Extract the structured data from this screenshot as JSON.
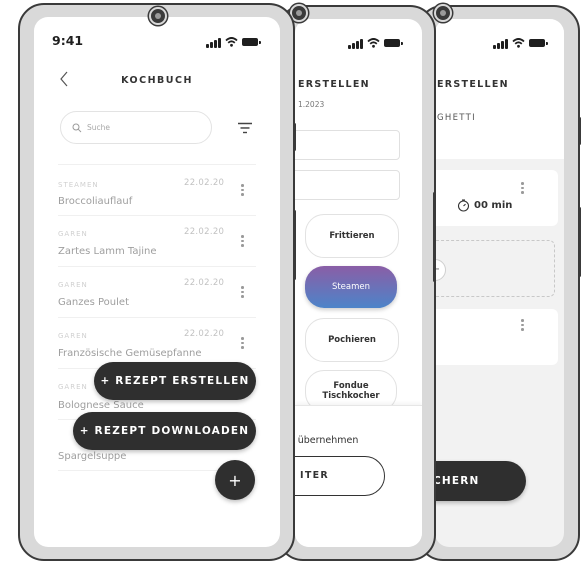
{
  "status": {
    "time": "9:41"
  },
  "phone1": {
    "title": "KOCHBUCH",
    "search_placeholder": "Suche",
    "recipes": [
      {
        "category": "STEAMEN",
        "date": "22.02.20",
        "name": "Broccoliauflauf"
      },
      {
        "category": "GAREN",
        "date": "22.02.20",
        "name": "Zartes Lamm Tajine"
      },
      {
        "category": "GAREN",
        "date": "22.02.20",
        "name": "Ganzes Poulet"
      },
      {
        "category": "GAREN",
        "date": "22.02.20",
        "name": "Französische Gemüsepfanne"
      },
      {
        "category": "GAREN",
        "date": "",
        "name": "Bolognese Sauce"
      },
      {
        "category": "",
        "date": "",
        "name": "Spargelsuppe"
      }
    ],
    "fab_create": "+ REZEPT ERSTELLEN",
    "fab_download": "+ REZEPT DOWNLOADEN",
    "fab_plus": "+"
  },
  "phone2": {
    "title": "ERSTELLEN",
    "date": "1.2023",
    "methods": [
      "Frittieren",
      "Steamen",
      "Pochieren",
      "Fondue Tischkocher"
    ],
    "selected_method": "Steamen",
    "bottom_text": "t übernehmen",
    "bottom_button": "ITER"
  },
  "phone3": {
    "title": "ERSTELLEN",
    "subtitle": "GHETTI",
    "timer": "00 min",
    "add_symbol": "+",
    "save_button": "CHERN"
  },
  "colors": {
    "dark": "#2f2f2f",
    "accent_gradient_top": "#8a5ea6",
    "accent_gradient_bottom": "#4d84c9"
  }
}
